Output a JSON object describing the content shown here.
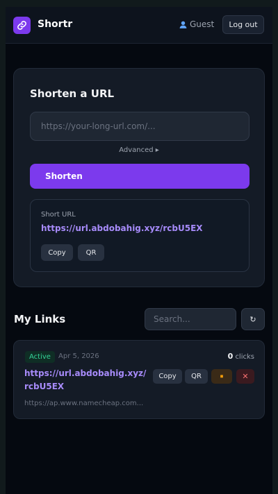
{
  "header": {
    "brand": "Shortr",
    "user_label": "Guest",
    "logout_label": "Log out",
    "icons": {
      "logo": "link-icon",
      "user": "user-icon"
    }
  },
  "shorten_card": {
    "title": "Shorten a URL",
    "url_placeholder": "https://your-long-url.com/...",
    "url_value": "",
    "advanced_label": "Advanced ▸",
    "submit_label": "Shorten",
    "result": {
      "label": "Short URL",
      "short_url": "https://url.abdobahig.xyz/rcbU5EX",
      "copy_label": "Copy",
      "qr_label": "QR"
    }
  },
  "my_links": {
    "title": "My Links",
    "search_placeholder": "Search...",
    "refresh_label": "↻",
    "items": [
      {
        "status": "Active",
        "date": "Apr 5, 2026",
        "clicks": "0",
        "clicks_label": "clicks",
        "short_url": "https://url.abdobahig.xyz/rcbU5EX",
        "original_url": "https://ap.www.namecheap.com...",
        "copy_label": "Copy",
        "qr_label": "QR",
        "pause_label": "⏹",
        "delete_label": "✕"
      }
    ]
  },
  "colors": {
    "accent": "#7c3aed",
    "link": "#a78bfa",
    "active": "#34d399",
    "danger": "#f87171",
    "warning": "#f59e0b"
  }
}
